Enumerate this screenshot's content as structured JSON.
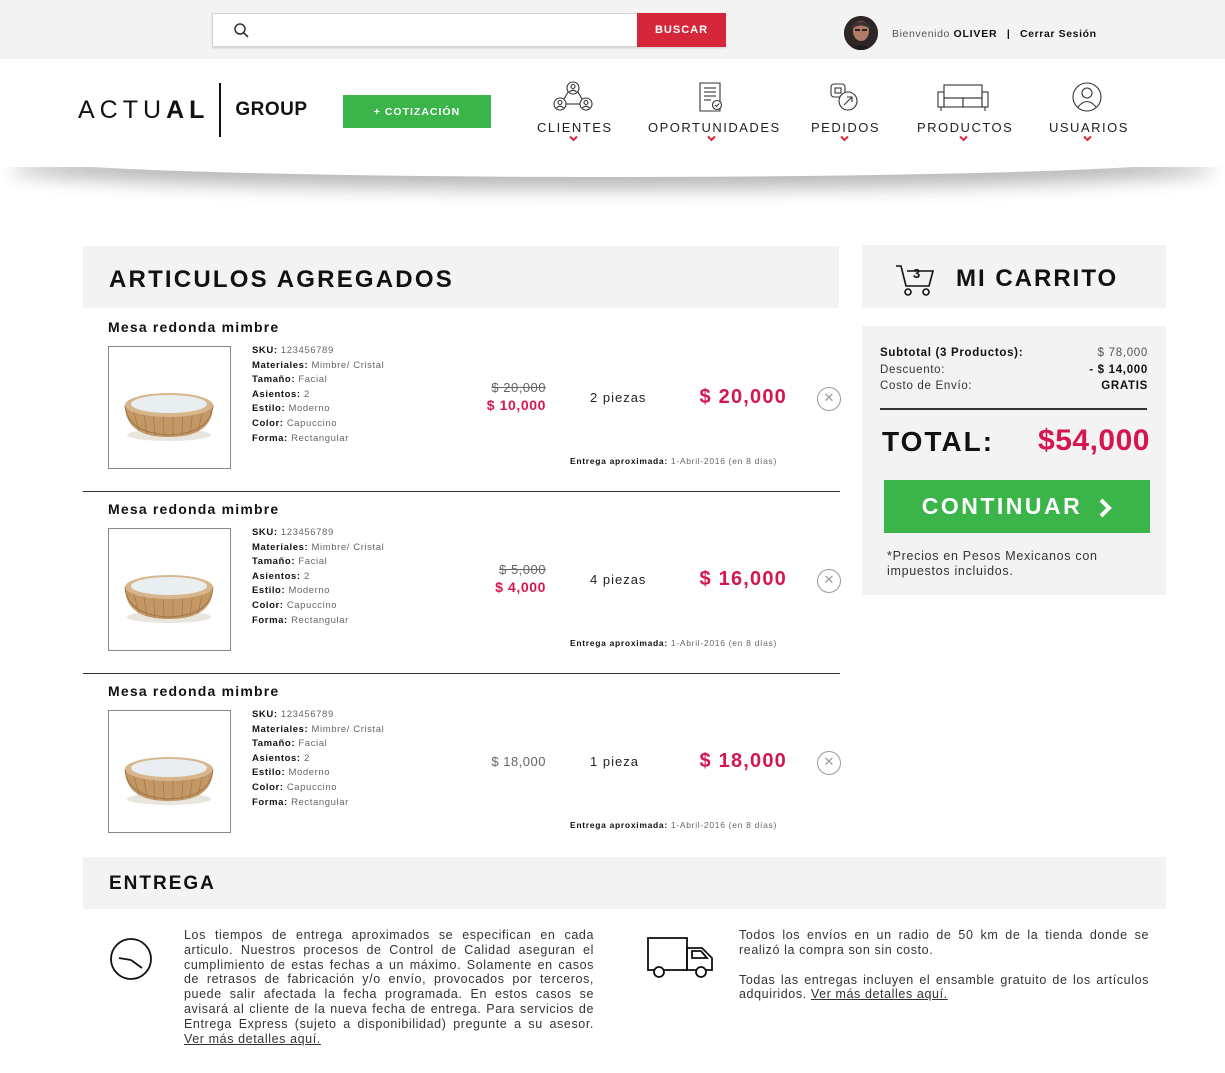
{
  "topbar": {
    "search_placeholder": "",
    "search_button": "BUSCAR",
    "welcome_prefix": "Bienvenido",
    "user_name": "OLIVER",
    "separator": "|",
    "logout": "Cerrar Sesión"
  },
  "header": {
    "logo_main_light": "ACTU",
    "logo_main_bold": "AL",
    "logo_group": "GROUP",
    "quote_button": "+ COTIZACIÓN",
    "nav": [
      {
        "label": "CLIENTES",
        "icon": "clients-icon"
      },
      {
        "label": "OPORTUNIDADES",
        "icon": "document-icon"
      },
      {
        "label": "PEDIDOS",
        "icon": "orders-icon"
      },
      {
        "label": "PRODUCTOS",
        "icon": "sofa-icon"
      },
      {
        "label": "USUARIOS",
        "icon": "user-icon"
      }
    ]
  },
  "articles": {
    "title": "ARTICULOS AGREGADOS",
    "spec_labels": {
      "sku": "SKU:",
      "materiales": "Materiales:",
      "tamano": "Tamaño:",
      "asientos": "Asientos:",
      "estilo": "Estilo:",
      "color": "Color:",
      "forma": "Forma:"
    },
    "delivery_label": "Entrega aproximada:",
    "items": [
      {
        "name": "Mesa redonda mimbre",
        "sku": "123456789",
        "materiales": "Mimbre/ Cristal",
        "tamano": "Facial",
        "asientos": "2",
        "estilo": "Moderno",
        "color": "Capuccino",
        "forma": "Rectangular",
        "price_old": "$ 20,000",
        "price_new": "$ 10,000",
        "qty": "2 piezas",
        "total": "$ 20,000",
        "delivery": "1-Abril-2016 (en 8 días)"
      },
      {
        "name": "Mesa redonda mimbre",
        "sku": "123456789",
        "materiales": "Mimbre/ Cristal",
        "tamano": "Facial",
        "asientos": "2",
        "estilo": "Moderno",
        "color": "Capuccino",
        "forma": "Rectangular",
        "price_old": "$ 5,000",
        "price_new": "$ 4,000",
        "qty": "4 piezas",
        "total": "$ 16,000",
        "delivery": "1-Abril-2016 (en 8 días)"
      },
      {
        "name": "Mesa redonda mimbre",
        "sku": "123456789",
        "materiales": "Mimbre/ Cristal",
        "tamano": "Facial",
        "asientos": "2",
        "estilo": "Moderno",
        "color": "Capuccino",
        "forma": "Rectangular",
        "price": "$ 18,000",
        "qty": "1 pieza",
        "total": "$ 18,000",
        "delivery": "1-Abril-2016 (en 8 días)"
      }
    ]
  },
  "cart": {
    "title": "MI CARRITO",
    "count": "3",
    "subtotal_label": "Subtotal (3 Productos):",
    "subtotal_value": "$ 78,000",
    "discount_label": "Descuento:",
    "discount_value": "- $ 14,000",
    "shipping_label": "Costo de Envío:",
    "shipping_value": "GRATIS",
    "total_label": "TOTAL:",
    "total_value": "$54,000",
    "continue_button": "CONTINUAR",
    "note": "*Precios en Pesos Mexicanos con impuestos incluidos."
  },
  "entrega": {
    "title": "ENTREGA",
    "text1": "Los tiempos de entrega aproximados se especifican en cada articulo. Nuestros procesos de Control de Calidad aseguran el cumplimiento de estas fechas a un máximo. Solamente en casos de retrasos de fabricación y/o envío, provocados por terceros, puede salir afectada la fecha programada. En estos casos se avisará al cliente de la nueva fecha de entrega. Para servicios de Entrega Express (sujeto a disponibilidad) pregunte a su asesor. ",
    "link1": "Ver más detalles aquí.",
    "text2a": "Todos los envíos en un radio de 50 km de la tienda donde se realizó la compra son sin costo.",
    "text2b": "Todas las entregas incluyen el ensamble gratuito de los artículos adquiridos. ",
    "link2": "Ver más detalles aquí."
  },
  "colors": {
    "accent_red": "#d5263a",
    "price_red": "#d5174f",
    "green": "#3bb54a",
    "panel_gray": "#f3f3f3"
  }
}
